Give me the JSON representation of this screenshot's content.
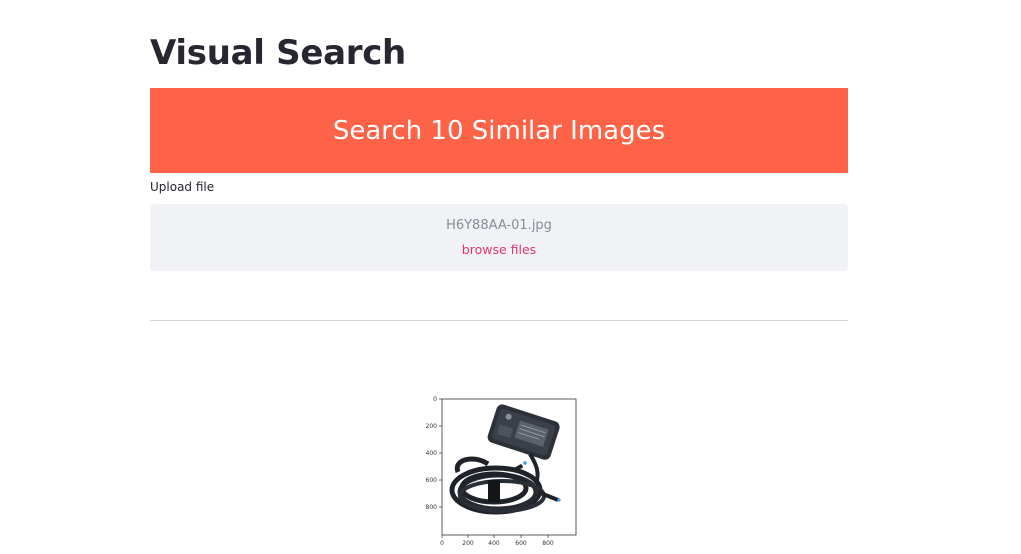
{
  "page": {
    "title": "Visual Search"
  },
  "banner": {
    "label": "Search 10 Similar Images",
    "color": "#ff6347"
  },
  "uploader": {
    "label": "Upload file",
    "file_name": "H6Y88AA-01.jpg",
    "browse_label": "browse files",
    "link_color": "#e5366a"
  },
  "result_plot": {
    "y_ticks": [
      "0",
      "200",
      "400",
      "600",
      "800"
    ],
    "x_ticks": [
      "0",
      "200",
      "400",
      "600",
      "800"
    ],
    "image_subject": "laptop-power-adapter"
  }
}
